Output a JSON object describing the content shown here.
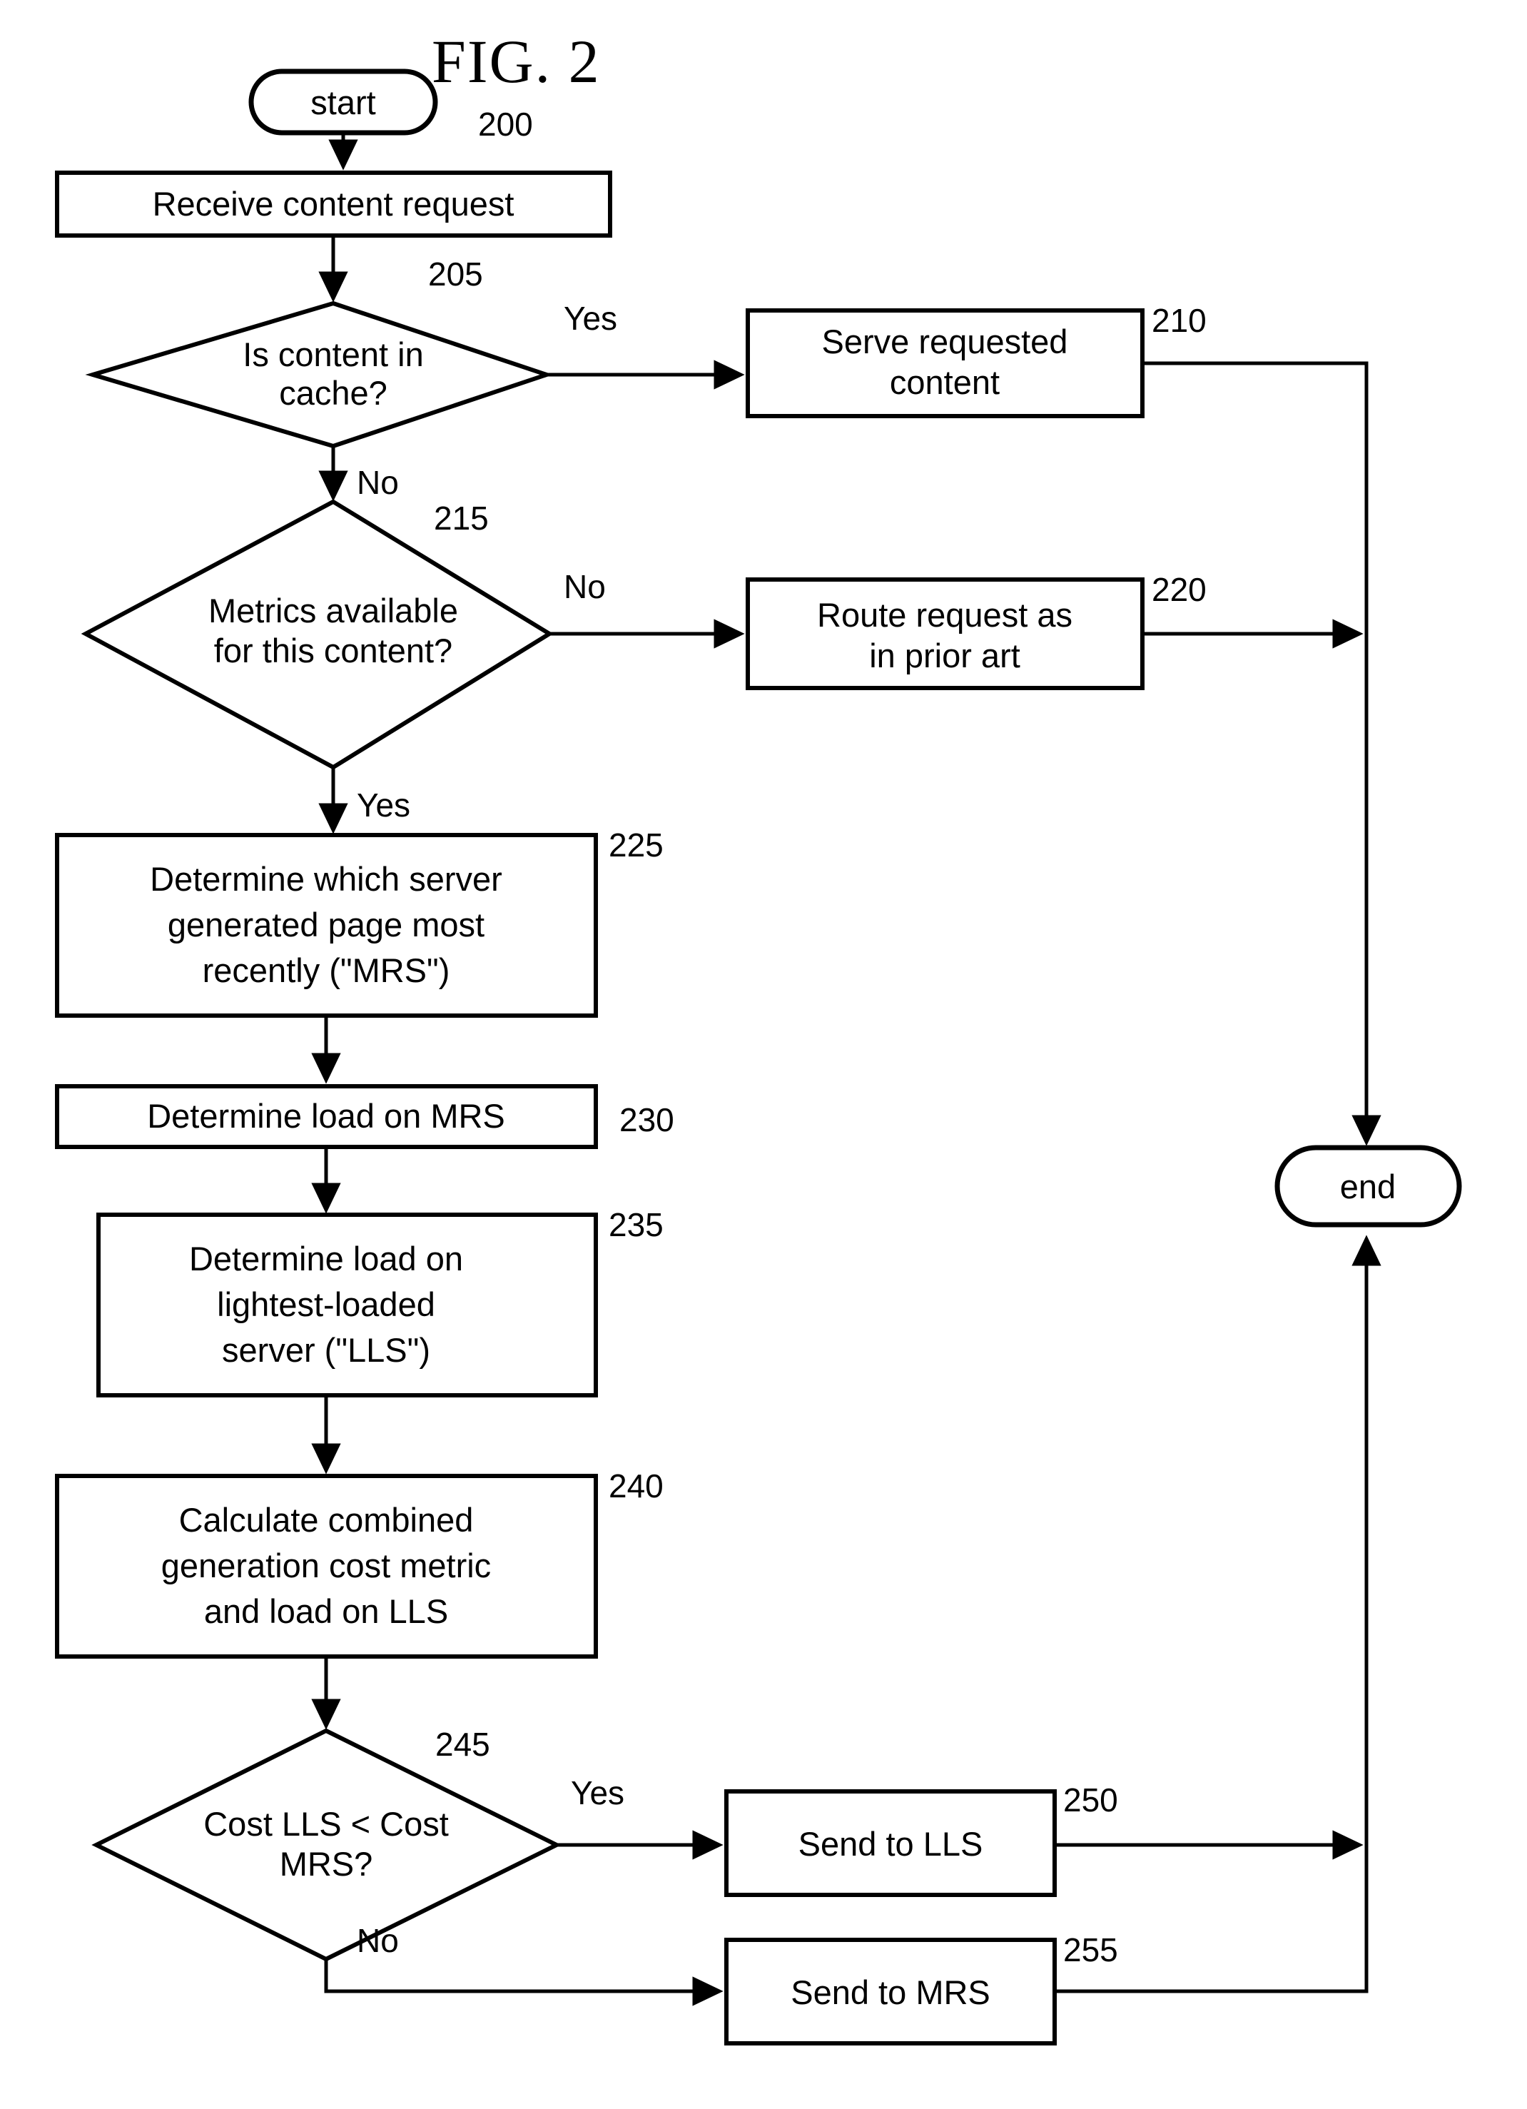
{
  "figure": {
    "title": "FIG. 2",
    "diagram_ref": "200"
  },
  "nodes": {
    "start": {
      "label": "start",
      "shape": "terminator"
    },
    "receive": {
      "label": "Receive content request",
      "shape": "process",
      "ref": ""
    },
    "cache_q": {
      "line1": "Is content in",
      "line2": "cache?",
      "shape": "decision",
      "ref": "205"
    },
    "serve": {
      "line1": "Serve requested",
      "line2": "content",
      "shape": "process",
      "ref": "210"
    },
    "metrics_q": {
      "line1": "Metrics available",
      "line2": "for this content?",
      "shape": "decision",
      "ref": "215"
    },
    "route_prior": {
      "line1": "Route request as",
      "line2": "in prior art",
      "shape": "process",
      "ref": "220"
    },
    "determine_mrs": {
      "line1": "Determine which server",
      "line2": "generated page most",
      "line3": "recently (\"MRS\")",
      "shape": "process",
      "ref": "225"
    },
    "load_mrs": {
      "label": "Determine load on MRS",
      "shape": "process",
      "ref": "230"
    },
    "load_lls": {
      "line1": "Determine load on",
      "line2": "lightest-loaded",
      "line3": "server (\"LLS\")",
      "shape": "process",
      "ref": "235"
    },
    "calc_cost": {
      "line1": "Calculate combined",
      "line2": "generation cost metric",
      "line3": "and load on LLS",
      "shape": "process",
      "ref": "240"
    },
    "cost_q": {
      "line1": "Cost LLS < Cost",
      "line2": "MRS?",
      "shape": "decision",
      "ref": "245"
    },
    "send_lls": {
      "label": "Send to LLS",
      "shape": "process",
      "ref": "250"
    },
    "send_mrs": {
      "label": "Send to MRS",
      "shape": "process",
      "ref": "255"
    },
    "end": {
      "label": "end",
      "shape": "terminator"
    }
  },
  "branch_labels": {
    "cache_yes": "Yes",
    "cache_no": "No",
    "metrics_no": "No",
    "metrics_yes": "Yes",
    "cost_yes": "Yes",
    "cost_no": "No"
  },
  "colors": {
    "stroke": "#000000",
    "fill": "#ffffff",
    "text": "#000000"
  }
}
